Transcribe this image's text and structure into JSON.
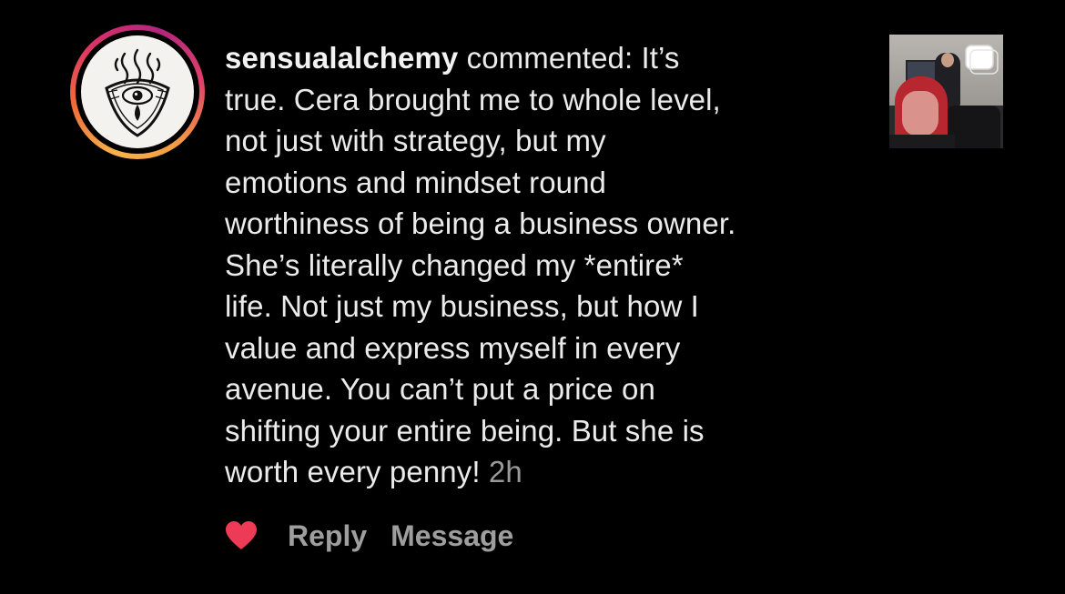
{
  "comment": {
    "username": "sensualalchemy",
    "action_text": " commented: It’s\ntrue. Cera brought me to whole level,\nnot just with strategy, but my\nemotions and mindset round\nworthiness of being a business owner.\nShe’s literally changed my *entire*\nlife. Not just my business, but how I\nvalue and express myself in every\navenue. You can’t put a price on\nshifting your entire being. But she is\nworth every penny! ",
    "timestamp": "2h"
  },
  "actions": {
    "reply_label": "Reply",
    "message_label": "Message"
  },
  "icons": {
    "like": "heart-icon",
    "avatar": "profile-logo-icon",
    "thumbnail_badge": "chat-bubble-icon"
  },
  "colors": {
    "background": "#000000",
    "text": "#ebebeb",
    "muted": "#9e9e9e",
    "heart": "#ed3a55",
    "ring_start": "#f7b24a",
    "ring_end": "#d8306a"
  }
}
